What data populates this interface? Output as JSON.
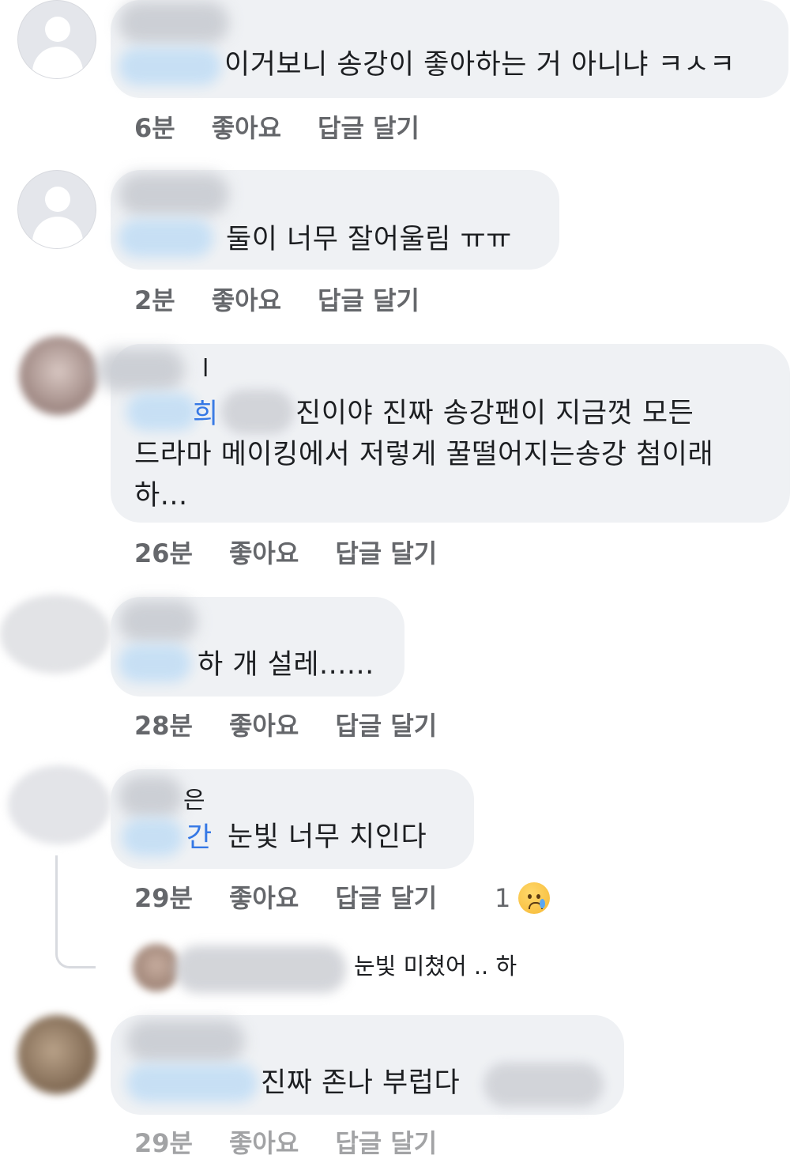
{
  "actions": {
    "like": "좋아요",
    "reply": "답글 달기"
  },
  "comments": [
    {
      "text": "이거보니 송강이 좋아하는 거 아니냐 ㅋㅅㅋ",
      "time": "6분"
    },
    {
      "text": "둘이 너무 잘어울림 ㅠㅠ",
      "time": "2분"
    },
    {
      "name_stub": "l",
      "mention_stub": "희",
      "line1": "진이야 진짜 송강팬이 지금껏 모든",
      "line2": "드라마 메이킹에서 저렇게 꿀떨어지는송강 첨이래",
      "line3": "하...",
      "time": "26분"
    },
    {
      "text": "하 개 설레......",
      "time": "28분"
    },
    {
      "name_stub": "은",
      "mention_stub": "간",
      "text": "눈빛 너무 치인다",
      "time": "29분",
      "reaction_count": "1",
      "reaction_icon": "sad-tear-emoji"
    },
    {
      "text": "진짜 존나 부럽다",
      "time": "29분"
    }
  ],
  "reply": {
    "text": "눈빛 미쳤어 .. 하"
  },
  "colors": {
    "bubble": "#eff1f4",
    "meta": "#65676b",
    "mention": "#3578e5"
  }
}
